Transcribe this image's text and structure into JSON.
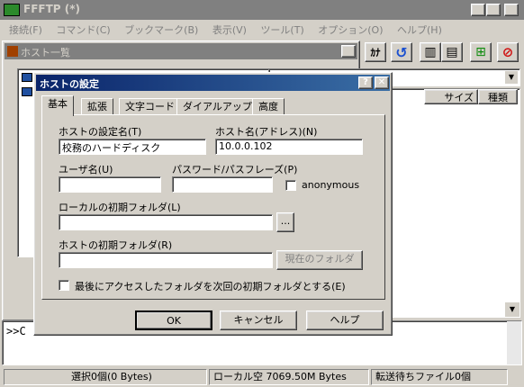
{
  "app": {
    "title": "FFFTP (*)"
  },
  "menu": [
    "接続(F)",
    "コマンド(C)",
    "ブックマーク(B)",
    "表示(V)",
    "ツール(T)",
    "オプション(O)",
    "ヘルプ(H)"
  ],
  "host_list": {
    "title": "ホスト一覧"
  },
  "file_pane": {
    "col_size": "サイズ",
    "col_type": "種類"
  },
  "log": {
    "prompt": ">>C"
  },
  "dialog": {
    "title": "ホストの設定",
    "tabs": [
      "基本",
      "拡張",
      "文字コード",
      "ダイアルアップ",
      "高度"
    ],
    "host_setting_name_label": "ホストの設定名(T)",
    "host_setting_name_value": "校務のハードディスク",
    "host_name_label": "ホスト名(アドレス)(N)",
    "host_name_value": "10.0.0.102",
    "user_label": "ユーザ名(U)",
    "user_value": "",
    "password_label": "パスワード/パスフレーズ(P)",
    "password_value": "",
    "anonymous_label": "anonymous",
    "local_folder_label": "ローカルの初期フォルダ(L)",
    "local_folder_value": "",
    "browse_label": "...",
    "host_folder_label": "ホストの初期フォルダ(R)",
    "host_folder_value": "",
    "current_folder_label": "現在のフォルダ",
    "last_folder_label": "最後にアクセスしたフォルダを次回の初期フォルダとする(E)",
    "ok_label": "OK",
    "cancel_label": "キャンセル",
    "help_label": "ヘルプ"
  },
  "status": {
    "selection": "選択0個(0 Bytes)",
    "local_free": "ローカル空 7069.50M Bytes",
    "queue": "転送待ちファイル0個"
  }
}
